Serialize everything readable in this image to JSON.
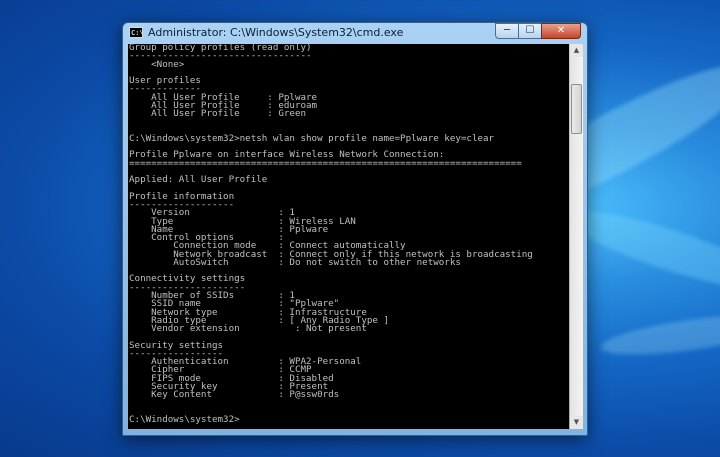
{
  "window": {
    "title": "Administrator: C:\\Windows\\System32\\cmd.exe",
    "icon_text": "C:\\",
    "icon": "cmd-icon",
    "controls": {
      "minimize": "─",
      "maximize": "☐",
      "close": "✕"
    }
  },
  "scrollbar": {
    "up": "▲",
    "down": "▼"
  },
  "console": {
    "text": "Group policy profiles (read only)\n---------------------------------\n    <None>\n\nUser profiles\n-------------\n    All User Profile     : Pplware\n    All User Profile     : eduroam\n    All User Profile     : Green\n\n\nC:\\Windows\\system32>netsh wlan show profile name=Pplware key=clear\n\nProfile Pplware on interface Wireless Network Connection:\n=======================================================================\n\nApplied: All User Profile\n\nProfile information\n-------------------\n    Version                : 1\n    Type                   : Wireless LAN\n    Name                   : Pplware\n    Control options        :\n        Connection mode    : Connect automatically\n        Network broadcast  : Connect only if this network is broadcasting\n        AutoSwitch         : Do not switch to other networks\n\nConnectivity settings\n---------------------\n    Number of SSIDs        : 1\n    SSID name              : \"Pplware\"\n    Network type           : Infrastructure\n    Radio type             : [ Any Radio Type ]\n    Vendor extension          : Not present\n\nSecurity settings\n-----------------\n    Authentication         : WPA2-Personal\n    Cipher                 : CCMP\n    FIPS mode              : Disabled\n    Security key           : Present\n    Key Content            : P@ssw0rds\n\n\nC:\\Windows\\system32>"
  }
}
